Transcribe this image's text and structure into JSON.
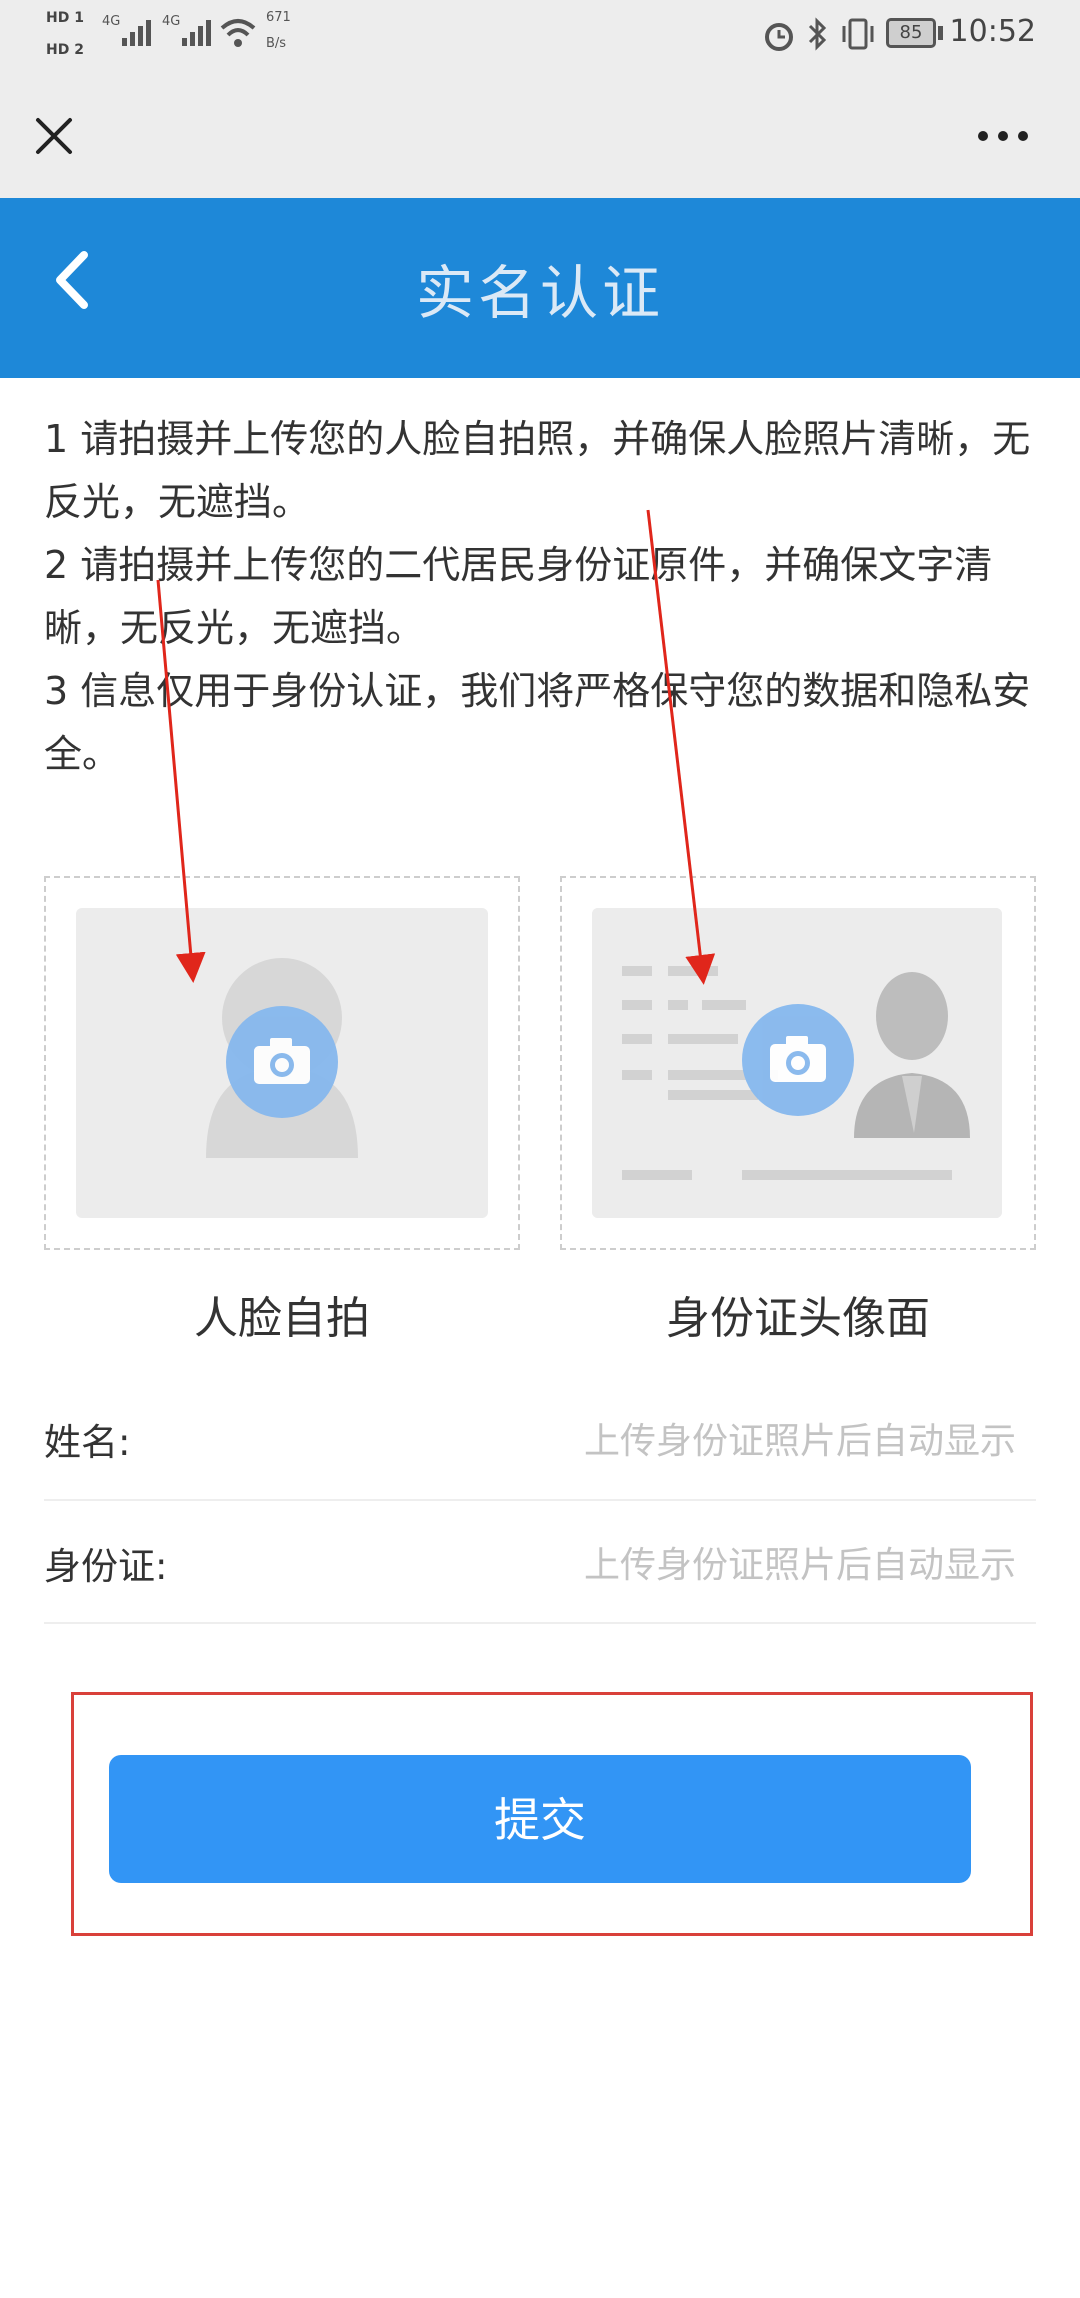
{
  "status_bar": {
    "sim1": "HD 1",
    "sim2": "HD 2",
    "network1": "4G",
    "network2": "4G",
    "speed_value": "671",
    "speed_unit": "B/s",
    "battery": "85",
    "time": "10:52"
  },
  "header": {
    "title": "实名认证"
  },
  "instructions": [
    "1 请拍摄并上传您的人脸自拍照，并确保人脸照片清晰，无反光，无遮挡。",
    "2 请拍摄并上传您的二代居民身份证原件，并确保文字清晰，无反光，无遮挡。",
    "3 信息仅用于身份认证，我们将严格保守您的数据和隐私安全。"
  ],
  "uploads": {
    "face_label": "人脸自拍",
    "id_label": "身份证头像面"
  },
  "form": {
    "name_label": "姓名:",
    "name_hint": "上传身份证照片后自动显示",
    "id_label": "身份证:",
    "id_hint": "上传身份证照片后自动显示"
  },
  "submit_label": "提交",
  "colors": {
    "header_blue": "#1e88d8",
    "button_blue": "#3295f5",
    "highlight_red": "#d9403a",
    "arrow_red": "#e0261b"
  }
}
